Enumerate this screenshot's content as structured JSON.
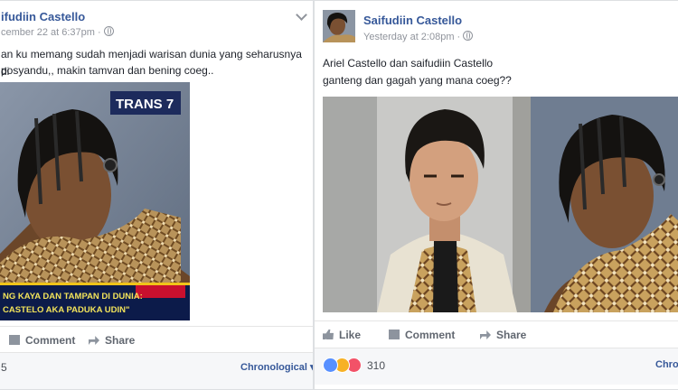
{
  "left_post": {
    "author": "ifudiin Castello",
    "timestamp": "cember 22 at 6:37pm ·",
    "text_line1": "an ku memang sudah menjadi warisan dunia yang seharusnya di",
    "text_line2": "posyandu,, makin tamvan dan bening coeg..",
    "photo": {
      "channel_logo": "TRANS 7",
      "caption_line1": "NG KAYA DAN TAMPAN DI DUNIA:",
      "caption_line2": "CASTELO AKA PADUKA UDIN\""
    },
    "actions": {
      "comment": "Comment",
      "share": "Share"
    },
    "reaction_count": "5",
    "sort_label": "Chronological"
  },
  "right_post": {
    "author": "Saifudiin Castello",
    "timestamp": "Yesterday at 2:08pm ·",
    "text_line1": "Ariel Castello dan saifudiin Castello",
    "text_line2": "ganteng dan gagah yang mana coeg??",
    "actions": {
      "like": "Like",
      "comment": "Comment",
      "share": "Share"
    },
    "reaction_count": "310",
    "sort_label": "Chrono"
  },
  "colors": {
    "link": "#365899",
    "like_blue": "#5890ff",
    "haha_yellow": "#f7b125",
    "love_red": "#f25268"
  }
}
